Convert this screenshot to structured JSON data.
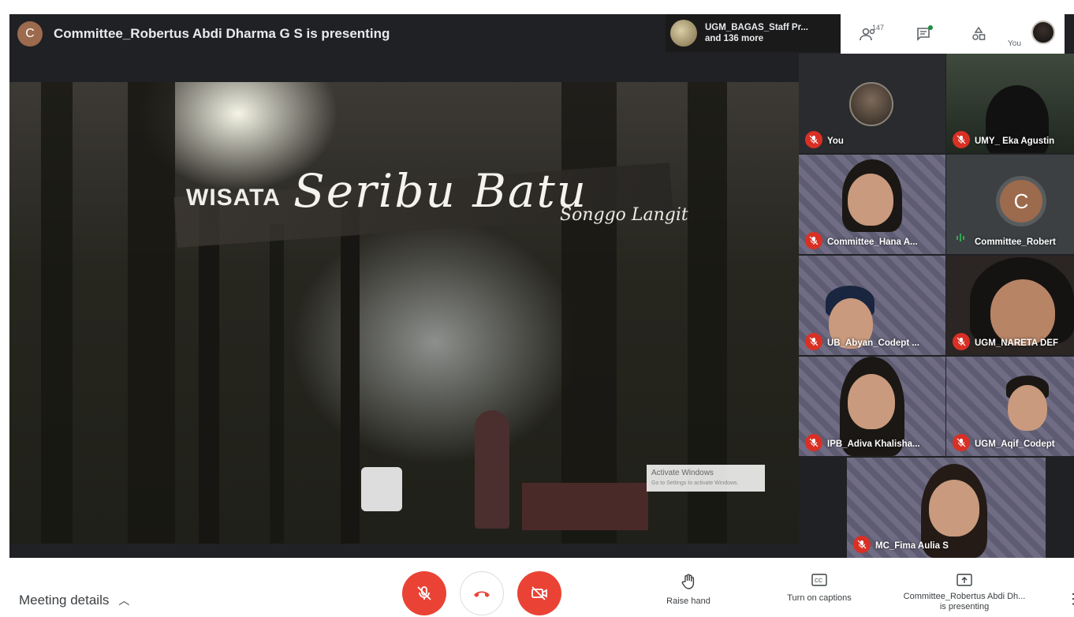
{
  "header": {
    "presenter_initial": "C",
    "presenter_text": "Committee_Robertus Abdi Dharma G S is presenting",
    "participants_chip_line1": "UGM_BAGAS_Staff Pr...",
    "participants_chip_line2": "and 136 more",
    "people_count": "147",
    "you_label": "You"
  },
  "screen_share": {
    "sign_left": "WISATA",
    "sign_main": "Seribu Batu",
    "sign_sub": "Songgo Langit",
    "activate_title": "Activate Windows",
    "activate_sub": "Go to Settings to activate Windows."
  },
  "tiles": [
    {
      "name": "You",
      "mic": "off"
    },
    {
      "name": "UMY_ Eka Agustin",
      "mic": "off"
    },
    {
      "name": "Committee_Hana A...",
      "mic": "off"
    },
    {
      "name": "Committee_Robert",
      "mic": "speaking",
      "initial": "C"
    },
    {
      "name": "UB_Abyan_Codept ...",
      "mic": "off"
    },
    {
      "name": "UGM_NARETA DEF",
      "mic": "off"
    },
    {
      "name": "IPB_Adiva Khalisha...",
      "mic": "off"
    },
    {
      "name": "UGM_Aqif_Codept",
      "mic": "off"
    },
    {
      "name": "MC_Fima Aulia S",
      "mic": "off"
    }
  ],
  "bottom": {
    "meeting_details": "Meeting details",
    "raise_hand": "Raise hand",
    "captions": "Turn on captions",
    "presenting_line1": "Committee_Robertus Abdi Dh...",
    "presenting_line2": "is presenting"
  },
  "colors": {
    "red": "#ea4335",
    "mic_off": "#d93025",
    "dark": "#202124",
    "avatar_brown": "#9c6a4d",
    "green": "#1e8e3e"
  }
}
